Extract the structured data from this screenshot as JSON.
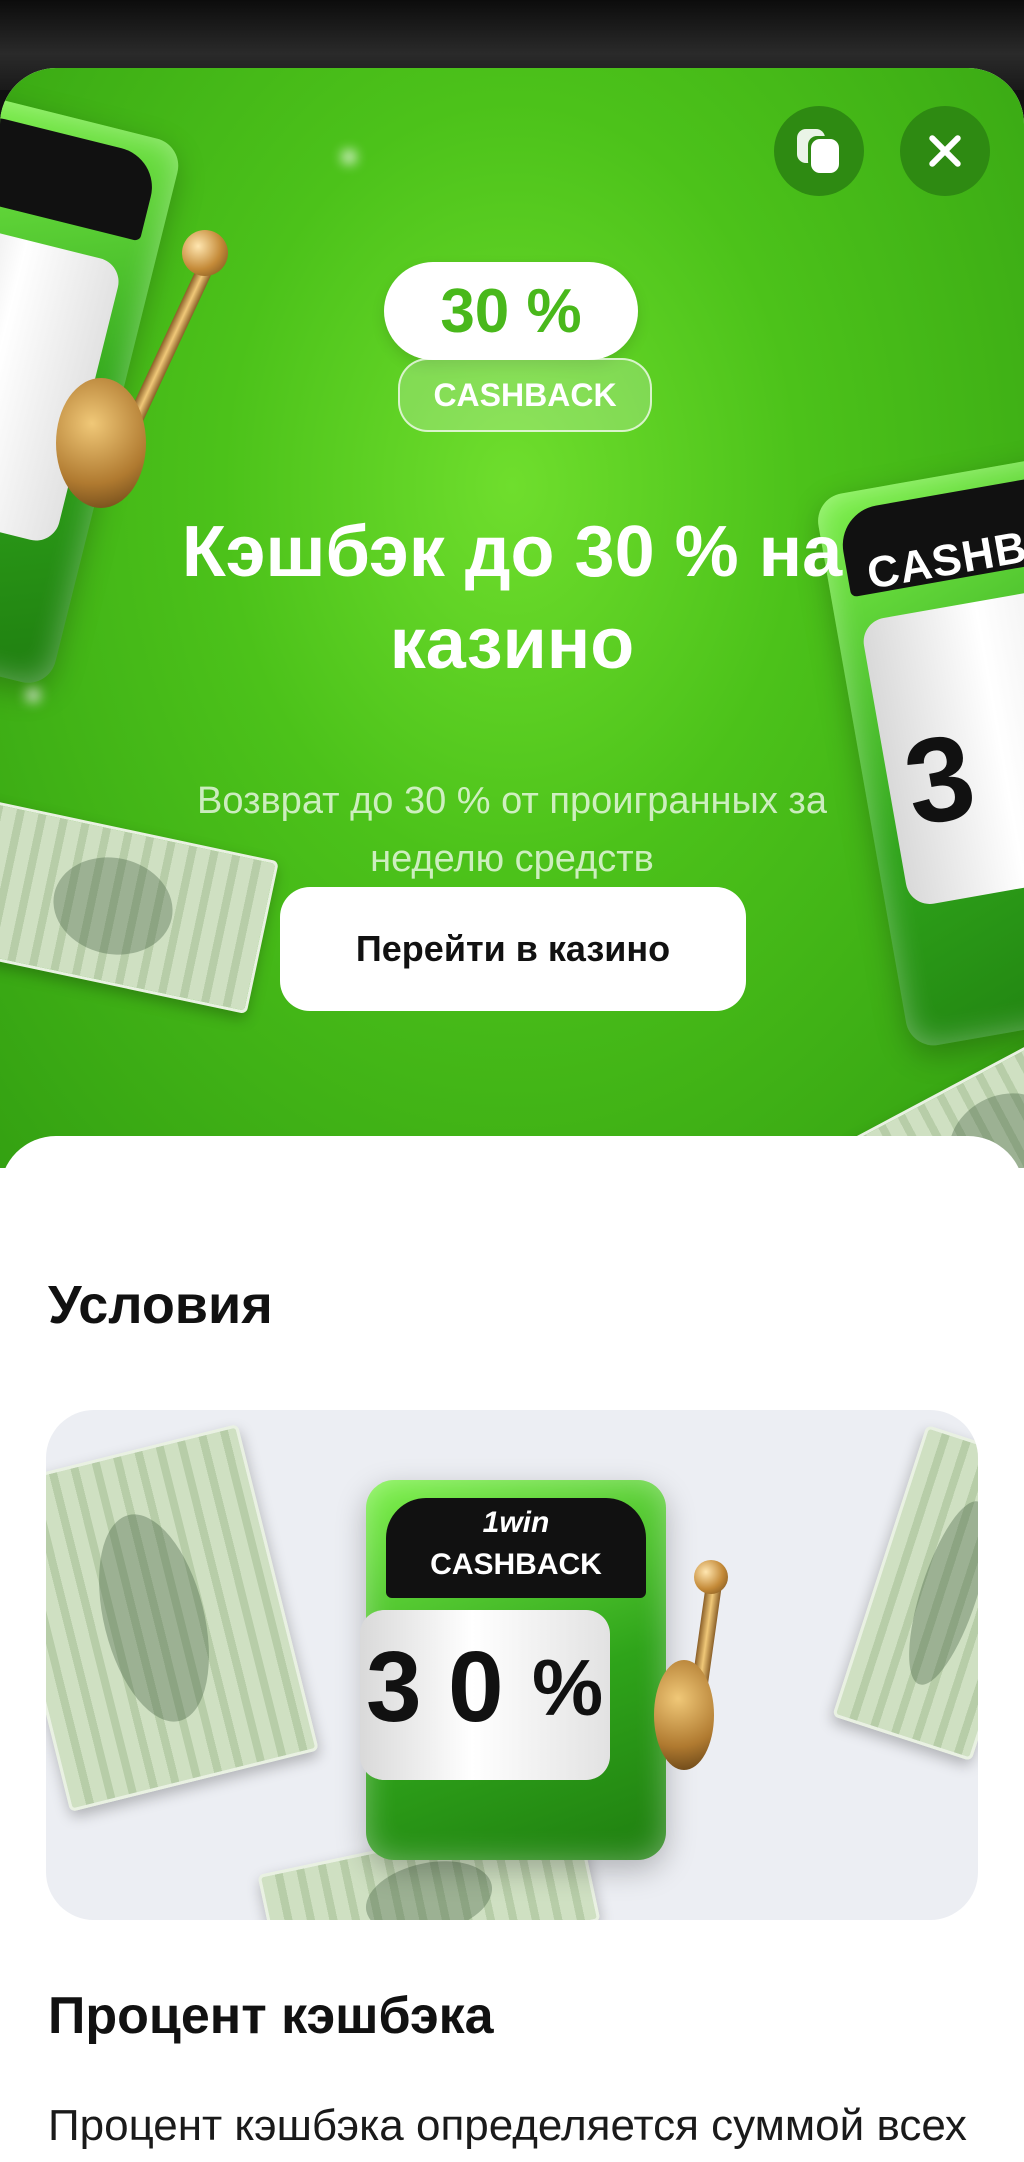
{
  "header": {
    "copy_icon": "copy-icon",
    "close_icon": "close-icon"
  },
  "hero": {
    "badge_value": "30 %",
    "badge_label": "CASHBACK",
    "title": "Кэшбэк до 30 % на казино",
    "description": "Возврат до 30 % от проигранных за неделю средств",
    "cta_label": "Перейти в казино",
    "colors": {
      "accent_green": "#4cc21a",
      "button_dark_green": "#2e8a12"
    }
  },
  "promo_image": {
    "brand": "1win",
    "label": "CASHBACK",
    "reels": [
      "3",
      "0",
      "%"
    ]
  },
  "conditions": {
    "title": "Условия"
  },
  "cashback_percent": {
    "title": "Процент кэшбэка",
    "text": "Процент кэшбэка определяется суммой всех ставок игрока на игры категории"
  }
}
